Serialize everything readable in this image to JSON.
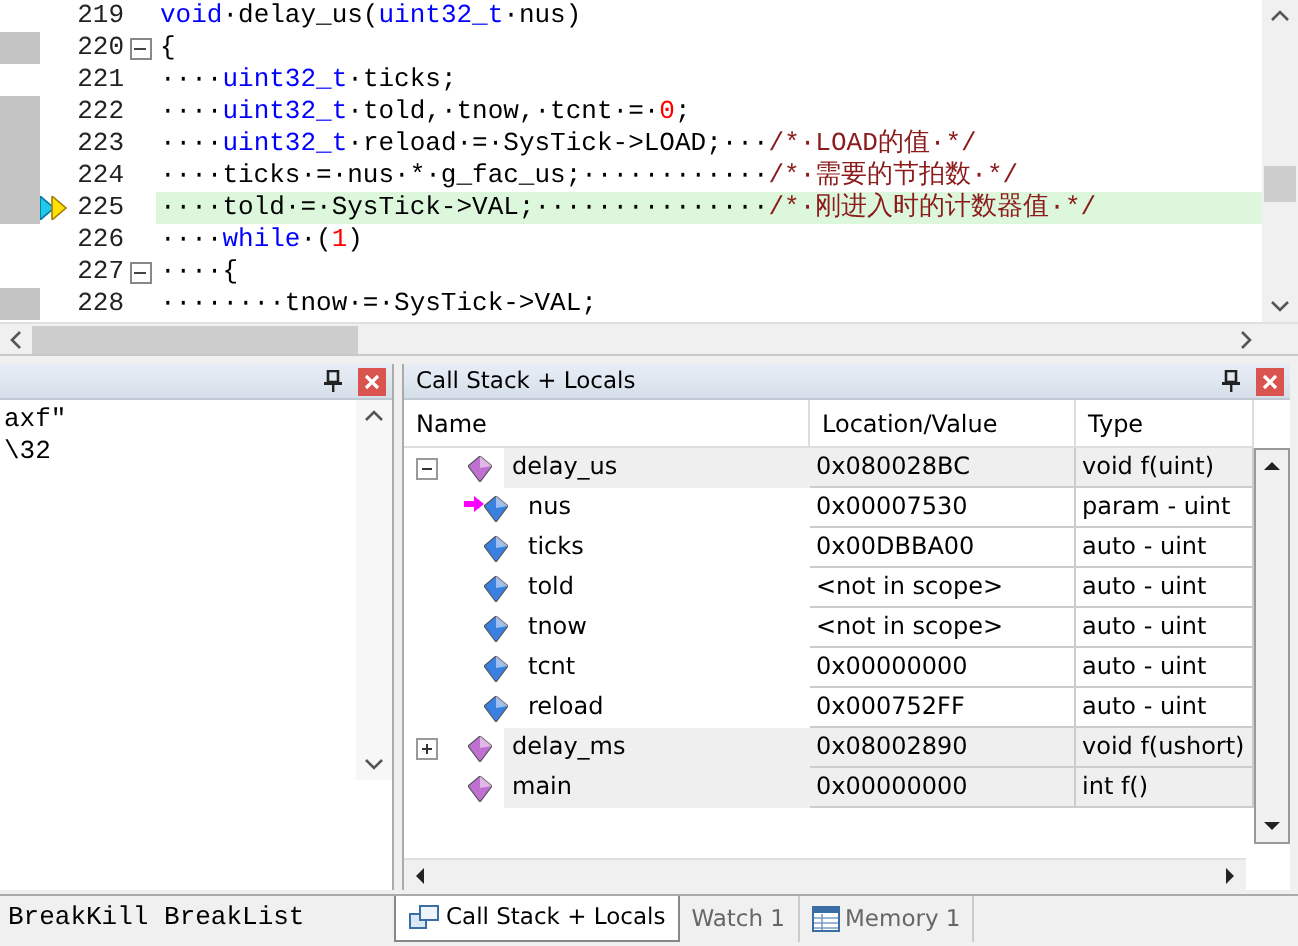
{
  "editor": {
    "lines": [
      {
        "number": "219",
        "executable": false,
        "current": false,
        "fold": false,
        "segments": [
          {
            "kind": "keyword",
            "text": "void"
          },
          {
            "kind": "plain",
            "text": "·delay_us("
          },
          {
            "kind": "keyword",
            "text": "uint32_t"
          },
          {
            "kind": "plain",
            "text": "·nus)"
          }
        ]
      },
      {
        "number": "220",
        "executable": true,
        "current": false,
        "fold": true,
        "segments": [
          {
            "kind": "plain",
            "text": "{"
          }
        ]
      },
      {
        "number": "221",
        "executable": false,
        "current": false,
        "fold": false,
        "segments": [
          {
            "kind": "plain",
            "text": "····"
          },
          {
            "kind": "keyword",
            "text": "uint32_t"
          },
          {
            "kind": "plain",
            "text": "·ticks;"
          }
        ]
      },
      {
        "number": "222",
        "executable": true,
        "current": false,
        "fold": false,
        "segments": [
          {
            "kind": "plain",
            "text": "····"
          },
          {
            "kind": "keyword",
            "text": "uint32_t"
          },
          {
            "kind": "plain",
            "text": "·told,·tnow,·tcnt·=·"
          },
          {
            "kind": "number",
            "text": "0"
          },
          {
            "kind": "plain",
            "text": ";"
          }
        ]
      },
      {
        "number": "223",
        "executable": true,
        "current": false,
        "fold": false,
        "segments": [
          {
            "kind": "plain",
            "text": "····"
          },
          {
            "kind": "keyword",
            "text": "uint32_t"
          },
          {
            "kind": "plain",
            "text": "·reload·=·SysTick->LOAD;···"
          },
          {
            "kind": "comment",
            "text": "/*·LOAD的值·*/"
          }
        ]
      },
      {
        "number": "224",
        "executable": true,
        "current": false,
        "fold": false,
        "segments": [
          {
            "kind": "plain",
            "text": "····ticks·=·nus·*·g_fac_us;············"
          },
          {
            "kind": "comment",
            "text": "/*·需要的节拍数·*/"
          }
        ]
      },
      {
        "number": "225",
        "executable": true,
        "current": true,
        "fold": false,
        "segments": [
          {
            "kind": "plain",
            "text": "····told·=·SysTick->VAL;···············"
          },
          {
            "kind": "comment",
            "text": "/*·刚进入时的计数器值·*/"
          }
        ]
      },
      {
        "number": "226",
        "executable": false,
        "current": false,
        "fold": false,
        "segments": [
          {
            "kind": "plain",
            "text": "····"
          },
          {
            "kind": "keyword",
            "text": "while"
          },
          {
            "kind": "plain",
            "text": "·("
          },
          {
            "kind": "number",
            "text": "1"
          },
          {
            "kind": "plain",
            "text": ")"
          }
        ]
      },
      {
        "number": "227",
        "executable": false,
        "current": false,
        "fold": true,
        "segments": [
          {
            "kind": "plain",
            "text": "····{"
          }
        ]
      },
      {
        "number": "228",
        "executable": true,
        "current": false,
        "fold": false,
        "segments": [
          {
            "kind": "plain",
            "text": "········tnow·=·SysTick->VAL;"
          }
        ]
      }
    ]
  },
  "output_panel": {
    "lines": [
      "axf\"",
      "\\32"
    ],
    "command_hint": "BreakKill BreakList"
  },
  "locals_panel": {
    "title": "Call Stack + Locals",
    "columns": [
      "Name",
      "Location/Value",
      "Type"
    ],
    "rows": [
      {
        "name": "delay_us",
        "value": "0x080028BC",
        "type": "void f(uint)",
        "expanded": true,
        "children": [
          {
            "name": "nus",
            "value": "0x00007530",
            "type": "param - uint",
            "current": true
          },
          {
            "name": "ticks",
            "value": "0x00DBBA00",
            "type": "auto - uint",
            "current": false
          },
          {
            "name": "told",
            "value": "<not in scope>",
            "type": "auto - uint",
            "current": false
          },
          {
            "name": "tnow",
            "value": "<not in scope>",
            "type": "auto - uint",
            "current": false
          },
          {
            "name": "tcnt",
            "value": "0x00000000",
            "type": "auto - uint",
            "current": false
          },
          {
            "name": "reload",
            "value": "0x000752FF",
            "type": "auto - uint",
            "current": false
          }
        ]
      },
      {
        "name": "delay_ms",
        "value": "0x08002890",
        "type": "void f(ushort)",
        "expanded": false
      },
      {
        "name": "main",
        "value": "0x00000000",
        "type": "int f()"
      }
    ]
  },
  "bottom_tabs": [
    {
      "label": "Call Stack + Locals",
      "selected": true,
      "kind": "stack"
    },
    {
      "label": "Watch 1",
      "selected": false,
      "kind": "plain"
    },
    {
      "label": "Memory 1",
      "selected": false,
      "kind": "memory"
    }
  ]
}
